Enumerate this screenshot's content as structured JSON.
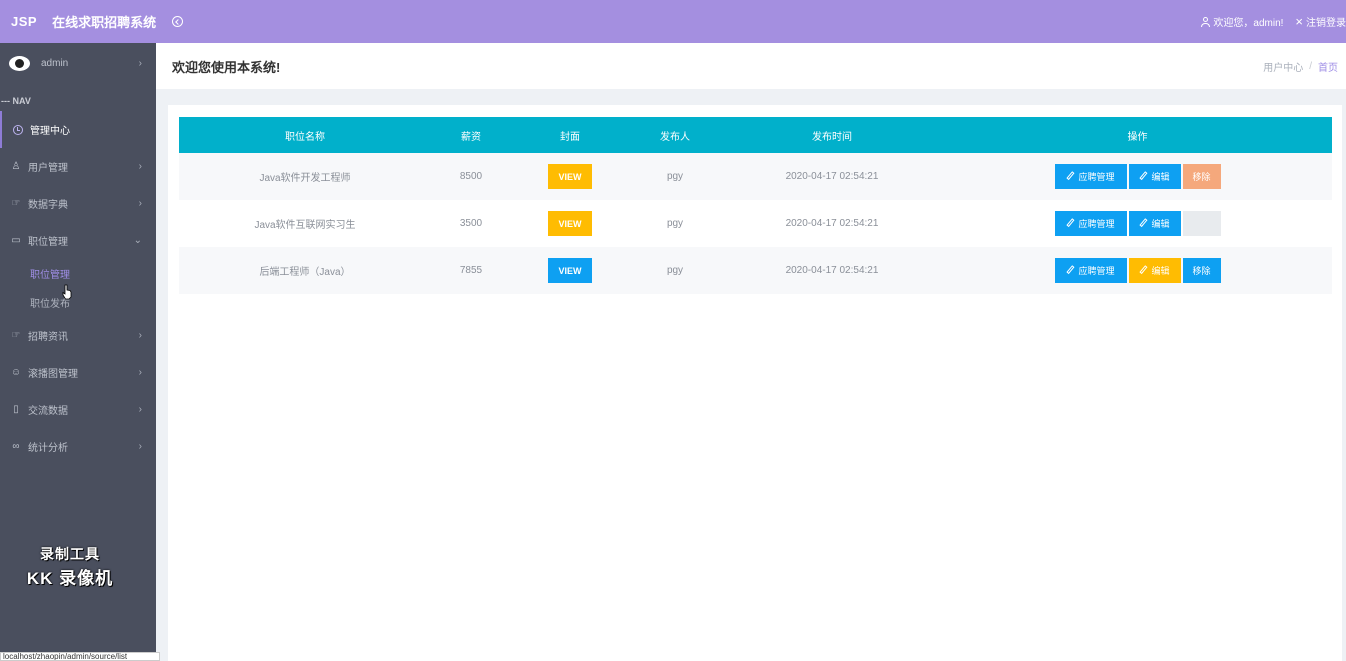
{
  "header": {
    "brand": "JSP",
    "system_title": "在线求职招聘系统",
    "welcome": "欢迎您，admin!",
    "logout": "注销登录"
  },
  "sidebar": {
    "username": "admin",
    "nav_header": "--- NAV",
    "items": [
      {
        "label": "管理中心",
        "icon": "clock-icon"
      },
      {
        "label": "用户管理",
        "icon": "bulb-icon"
      },
      {
        "label": "数据字典",
        "icon": "hand-icon"
      },
      {
        "label": "职位管理",
        "icon": "monitor-icon"
      },
      {
        "label": "招聘资讯",
        "icon": "hand-icon"
      },
      {
        "label": "滚播图管理",
        "icon": "smile-icon"
      },
      {
        "label": "交流数据",
        "icon": "phone-icon"
      },
      {
        "label": "统计分析",
        "icon": "link-icon"
      }
    ],
    "subitems": [
      {
        "label": "职位管理"
      },
      {
        "label": "职位发布"
      }
    ]
  },
  "watermark": {
    "line1": "录制工具",
    "line2": "KK 录像机"
  },
  "page": {
    "title": "欢迎您使用本系统!",
    "breadcrumb_home": "用户中心",
    "breadcrumb_sep": "/",
    "breadcrumb_current": "首页"
  },
  "table": {
    "headers": [
      "职位名称",
      "薪资",
      "封面",
      "发布人",
      "发布时间",
      "操作"
    ],
    "rows": [
      {
        "name": "Java软件开发工程师",
        "salary": "8500",
        "cover": "VIEW",
        "publisher": "pgy",
        "time": "2020-04-17 02:54:21"
      },
      {
        "name": "Java软件互联网实习生",
        "salary": "3500",
        "cover": "VIEW",
        "publisher": "pgy",
        "time": "2020-04-17 02:54:21"
      },
      {
        "name": "后端工程师（Java）",
        "salary": "7855",
        "cover": "VIEW",
        "publisher": "pgy",
        "time": "2020-04-17 02:54:21"
      }
    ],
    "actions": {
      "apply": "应聘管理",
      "edit": "编辑",
      "remove": "移除"
    }
  },
  "statusbar": {
    "url": "localhost/zhaopin/admin/source/list"
  },
  "colors": {
    "topbar": "#a48fe0",
    "sidebar": "#4a4f5e",
    "table_header": "#01b0cb",
    "btn_blue": "#0ea0f2",
    "btn_yellow": "#ffbc02",
    "btn_orange": "#f5a87c"
  }
}
